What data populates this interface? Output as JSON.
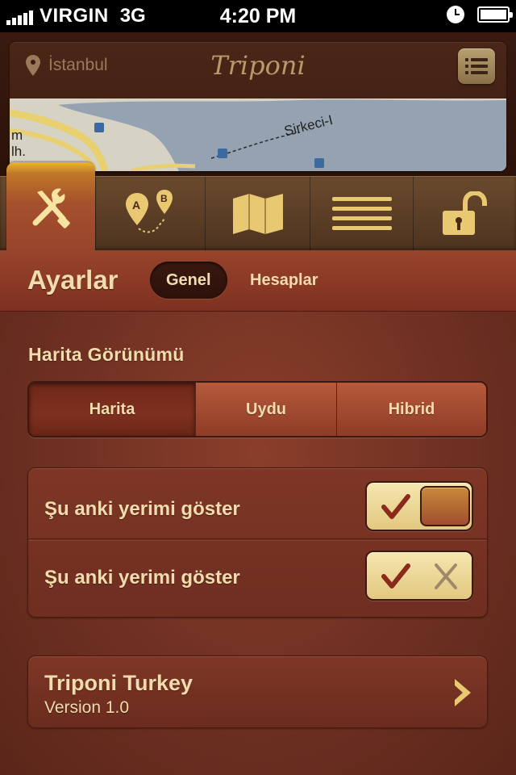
{
  "status_bar": {
    "carrier": "VIRGIN",
    "network": "3G",
    "time": "4:20 PM"
  },
  "header": {
    "location": "İstanbul",
    "logo": "Triponi",
    "map_label": "Sirkeci-I",
    "map_left_labels": [
      "m",
      "lh."
    ]
  },
  "tabs": [
    {
      "icon": "tools-icon",
      "active": true
    },
    {
      "icon": "route-icon",
      "active": false
    },
    {
      "icon": "map-icon",
      "active": false
    },
    {
      "icon": "list-icon",
      "active": false
    },
    {
      "icon": "unlock-icon",
      "active": false
    }
  ],
  "title_bar": {
    "title": "Ayarlar",
    "segments": [
      "Genel",
      "Hesaplar"
    ],
    "selected_segment": "Genel"
  },
  "content": {
    "map_view_title": "Harita Görünümü",
    "map_types": [
      "Harita",
      "Uydu",
      "Hibrid"
    ],
    "selected_map_type": "Harita",
    "settings": [
      {
        "label": "Şu anki yerimi göster",
        "state": "on"
      },
      {
        "label": "Şu anki yerimi göster",
        "state": "off"
      }
    ],
    "about": {
      "title": "Triponi Turkey",
      "version": "Version 1.0"
    }
  },
  "colors": {
    "accent_gold": "#e8c870",
    "text_cream": "#f2dcae",
    "toggle_check": "#8a2a1a"
  }
}
